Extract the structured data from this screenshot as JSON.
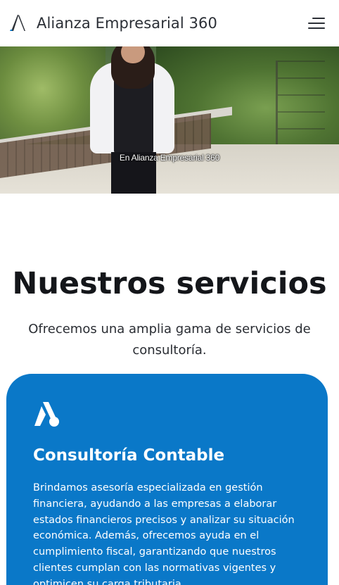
{
  "header": {
    "brand": "Alianza Empresarial 360",
    "logo_icon": "alianza-logo-icon",
    "menu_icon": "hamburger-menu-icon"
  },
  "hero": {
    "caption": "En Alianza Empresarial 360"
  },
  "services": {
    "title": "Nuestros servicios",
    "subtitle": "Ofrecemos una amplia gama de servicios de consultoría.",
    "cards": [
      {
        "icon": "alianza-a-icon",
        "title": "Consultoría Contable",
        "text": "Brindamos asesoría especializada en gestión financiera, ayudando a las empresas a elaborar estados financieros precisos y analizar su situación económica. Además, ofrecemos ayuda en el cumplimiento fiscal, garantizando que nuestros clientes cumplan con las normativas vigentes y optimicen su carga tributaria.",
        "color": "#0a78c8"
      }
    ]
  },
  "colors": {
    "brand_text": "#2b2f36",
    "card_blue": "#0a78c8",
    "heading": "#14161a"
  }
}
